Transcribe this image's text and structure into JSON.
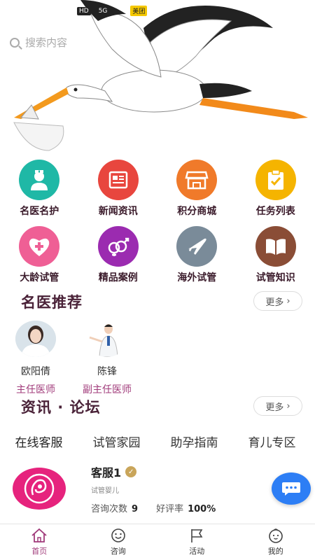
{
  "status_bar": {
    "hd": "HD",
    "signal": "5G",
    "vpn": "美团"
  },
  "search": {
    "placeholder": "搜索内容"
  },
  "colors": {
    "accent": "#a03a7a",
    "title": "#4a2238",
    "teal": "#1fb8a6",
    "red": "#e8463e",
    "orange": "#f07a2a",
    "yellow": "#f5b400",
    "pink": "#ef5f95",
    "purple": "#9b2bb0",
    "gray": "#7a8b99",
    "brown": "#8a4d36"
  },
  "grid": [
    {
      "label": "名医名护",
      "icon": "nurse-icon",
      "color": "#1fb8a6"
    },
    {
      "label": "新闻资讯",
      "icon": "newspaper-icon",
      "color": "#e8463e"
    },
    {
      "label": "积分商城",
      "icon": "store-icon",
      "color": "#f07a2a"
    },
    {
      "label": "任务列表",
      "icon": "clipboard-icon",
      "color": "#f5b400"
    },
    {
      "label": "大龄试管",
      "icon": "heart-plus-icon",
      "color": "#ef5f95"
    },
    {
      "label": "精品案例",
      "icon": "gender-icon",
      "color": "#9b2bb0"
    },
    {
      "label": "海外试管",
      "icon": "airplane-icon",
      "color": "#7a8b99"
    },
    {
      "label": "试管知识",
      "icon": "book-icon",
      "color": "#8a4d36"
    }
  ],
  "doctors_section": {
    "title": "名医推荐",
    "more": "更多"
  },
  "doctors": [
    {
      "name": "欧阳倩",
      "role": "主任医师"
    },
    {
      "name": "陈锋",
      "role": "副主任医师"
    }
  ],
  "forum_section": {
    "title": "资讯 · 论坛",
    "more": "更多"
  },
  "forum_tabs": [
    "在线客服",
    "试管家园",
    "助孕指南",
    "育儿专区"
  ],
  "service": {
    "name": "客服1",
    "subtitle": "试管婴儿",
    "consult_label": "咨询次数",
    "consult_value": "9",
    "rating_label": "好评率",
    "rating_value": "100%"
  },
  "bottom_nav": [
    {
      "label": "首页",
      "icon": "home-icon",
      "active": true
    },
    {
      "label": "咨询",
      "icon": "smile-icon",
      "active": false
    },
    {
      "label": "活动",
      "icon": "flag-icon",
      "active": false
    },
    {
      "label": "我的",
      "icon": "baby-face-icon",
      "active": false
    }
  ]
}
